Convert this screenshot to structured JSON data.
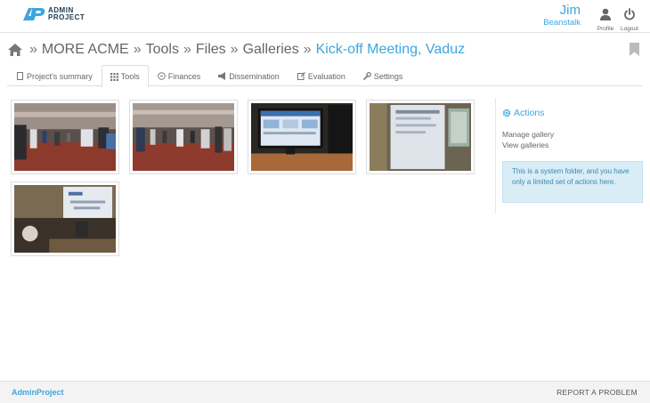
{
  "header": {
    "logo_line1": "ADMIN",
    "logo_line2": "PROJECT",
    "user_first_name": "Jim",
    "user_last_name": "Beanstalk",
    "profile_label": "Profile",
    "logout_label": "Logout"
  },
  "breadcrumb": {
    "items": [
      "MORE ACME",
      "Tools",
      "Files",
      "Galleries",
      "Kick-off Meeting, Vaduz"
    ],
    "separator": "»"
  },
  "tabs": [
    {
      "label": "Project's summary",
      "icon": "document-icon"
    },
    {
      "label": "Tools",
      "icon": "grid-icon"
    },
    {
      "label": "Finances",
      "icon": "coin-icon"
    },
    {
      "label": "Dissemination",
      "icon": "megaphone-icon"
    },
    {
      "label": "Evaluation",
      "icon": "edit-icon"
    },
    {
      "label": "Settings",
      "icon": "wrench-icon"
    }
  ],
  "gallery": {
    "photos": [
      "conference-hall-photo",
      "conference-hall-photo",
      "monitor-photo",
      "projection-screen-photo",
      "presentation-photo"
    ]
  },
  "sidebar": {
    "title": "Actions",
    "links": [
      "Manage gallery",
      "View galleries"
    ],
    "notice": "This is a system folder, and you have only a limited set of actions here."
  },
  "footer": {
    "brand": "AdminProject",
    "report": "REPORT A PROBLEM"
  },
  "colors": {
    "accent": "#3ba7de",
    "notice_bg": "#d9edf7",
    "notice_text": "#3a87ad"
  }
}
